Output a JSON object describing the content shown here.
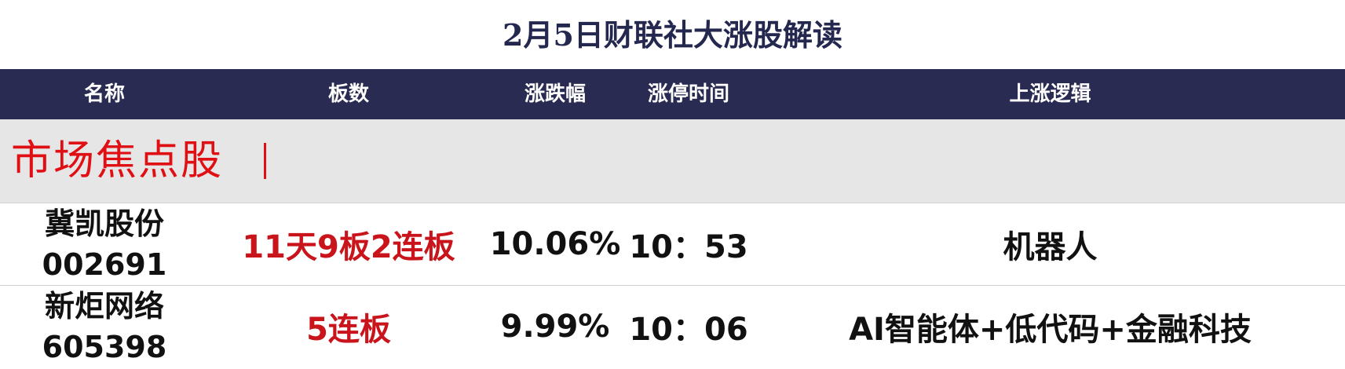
{
  "title": "2月5日财联社大涨股解读",
  "header": {
    "name": "名称",
    "boards": "板数",
    "change": "涨跌幅",
    "limit_time": "涨停时间",
    "logic": "上涨逻辑"
  },
  "section": {
    "label": "市场焦点股"
  },
  "colors": {
    "header_bg": "#292b52",
    "section_bg": "#e6e6e6",
    "accent_red": "#e00f14",
    "board_red": "#c8141a",
    "title_navy": "#24284f"
  },
  "rows": [
    {
      "name": "冀凯股份",
      "code": "002691",
      "boards": "11天9板2连板",
      "change": "10.06%",
      "limit_time": "10：53",
      "logic": "机器人"
    },
    {
      "name": "新炬网络",
      "code": "605398",
      "boards": "5连板",
      "change": "9.99%",
      "limit_time": "10：06",
      "logic": "AI智能体+低代码+金融科技"
    }
  ]
}
